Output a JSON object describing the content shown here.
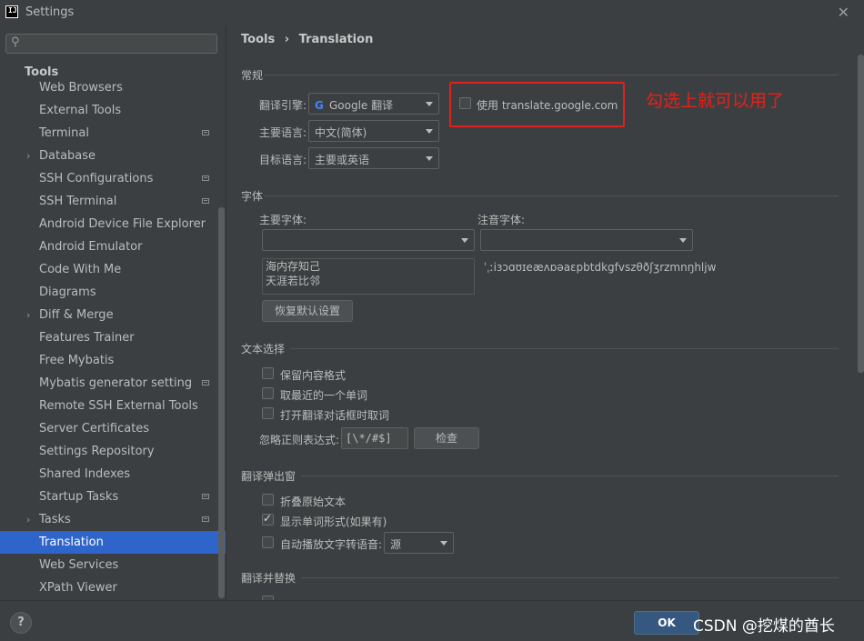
{
  "window": {
    "title": "Settings",
    "app_icon_text": "IJ"
  },
  "sidebar": {
    "search_placeholder": "",
    "header": "Tools",
    "items": [
      {
        "label": "Web Browsers",
        "expandable": false,
        "project": false
      },
      {
        "label": "External Tools",
        "expandable": false,
        "project": false
      },
      {
        "label": "Terminal",
        "expandable": false,
        "project": true
      },
      {
        "label": "Database",
        "expandable": true,
        "project": false
      },
      {
        "label": "SSH Configurations",
        "expandable": false,
        "project": true
      },
      {
        "label": "SSH Terminal",
        "expandable": false,
        "project": true
      },
      {
        "label": "Android Device File Explorer",
        "expandable": false,
        "project": false
      },
      {
        "label": "Android Emulator",
        "expandable": false,
        "project": false
      },
      {
        "label": "Code With Me",
        "expandable": false,
        "project": false
      },
      {
        "label": "Diagrams",
        "expandable": false,
        "project": false
      },
      {
        "label": "Diff & Merge",
        "expandable": true,
        "project": false
      },
      {
        "label": "Features Trainer",
        "expandable": false,
        "project": false
      },
      {
        "label": "Free Mybatis",
        "expandable": false,
        "project": false
      },
      {
        "label": "Mybatis generator setting",
        "expandable": false,
        "project": true
      },
      {
        "label": "Remote SSH External Tools",
        "expandable": false,
        "project": false
      },
      {
        "label": "Server Certificates",
        "expandable": false,
        "project": false
      },
      {
        "label": "Settings Repository",
        "expandable": false,
        "project": false
      },
      {
        "label": "Shared Indexes",
        "expandable": false,
        "project": false
      },
      {
        "label": "Startup Tasks",
        "expandable": false,
        "project": true
      },
      {
        "label": "Tasks",
        "expandable": true,
        "project": true
      },
      {
        "label": "Translation",
        "expandable": false,
        "project": false,
        "selected": true
      },
      {
        "label": "Web Services",
        "expandable": false,
        "project": false
      },
      {
        "label": "XPath Viewer",
        "expandable": false,
        "project": false
      }
    ]
  },
  "breadcrumb": {
    "parent": "Tools",
    "separator": "›",
    "current": "Translation"
  },
  "general": {
    "title": "常规",
    "engine_label": "翻译引擎:",
    "engine_value": "Google 翻译",
    "google_checkbox_label": "使用 translate.google.com",
    "google_checkbox_checked": false,
    "primary_lang_label": "主要语言:",
    "primary_lang_value": "中文(简体)",
    "target_lang_label": "目标语言:",
    "target_lang_value": "主要或英语"
  },
  "annotation_text": "勾选上就可以用了",
  "font": {
    "title": "字体",
    "primary_label": "主要字体:",
    "phonetic_label": "注音字体:",
    "primary_value": "",
    "phonetic_value": "",
    "preview_line1": "海内存知己",
    "preview_line2": "天涯若比邻",
    "phonetic_sample": "ˈˌːiɜɔɑʊɪeæʌɒəaɛpbtdkgfvszθðʃʒrzmnŋhljw",
    "restore_button": "恢复默认设置"
  },
  "selection": {
    "title": "文本选择",
    "opt1": "保留内容格式",
    "opt2": "取最近的一个单词",
    "opt3": "打开翻译对话框时取词",
    "opt1_checked": false,
    "opt2_checked": false,
    "opt3_checked": false,
    "regex_label": "忽略正则表达式:",
    "regex_value": "[\\*/#$]",
    "check_button": "检查"
  },
  "popup": {
    "title": "翻译弹出窗",
    "opt1": "折叠原始文本",
    "opt2": "显示单词形式(如果有)",
    "opt3": "自动播放文字转语音:",
    "opt1_checked": false,
    "opt2_checked": true,
    "opt3_checked": false,
    "tts_value": "源"
  },
  "replace": {
    "title": "翻译并替换"
  },
  "footer": {
    "help": "?",
    "ok": "OK",
    "watermark": "CSDN @挖煤的酋长"
  },
  "colors": {
    "accent": "#2f65ca",
    "annotation": "#e8201a",
    "ok_button": "#365880"
  }
}
